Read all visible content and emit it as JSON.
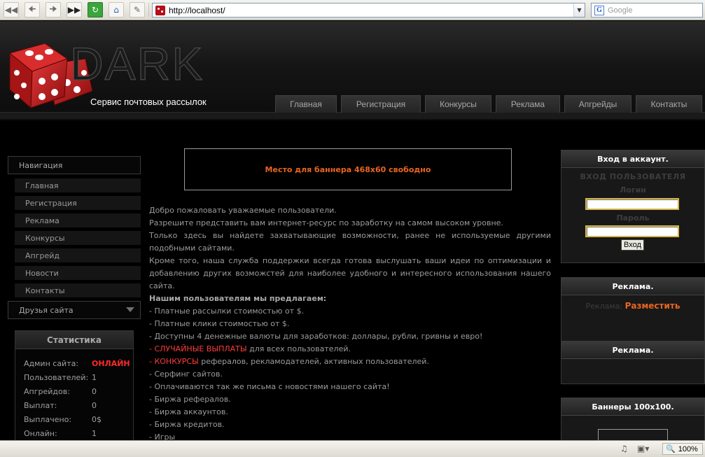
{
  "browser": {
    "url": "http://localhost/",
    "search_placeholder": "Google",
    "zoom": "100%",
    "icons": [
      "back-icon",
      "forward-icon",
      "fast-forward-icon",
      "refresh-icon",
      "home-icon",
      "edit-icon",
      "favicon-icon",
      "search-google-icon",
      "speaker-icon",
      "camera-icon",
      "zoom-icon"
    ]
  },
  "header": {
    "logo_text": "DARK",
    "slogan": "Сервис почтовых рассылок",
    "nav": [
      "Главная",
      "Регистрация",
      "Конкурсы",
      "Реклама",
      "Апгрейды",
      "Контакты"
    ]
  },
  "sidebar": {
    "nav_title": "Навигация",
    "items": [
      "Главная",
      "Регистрация",
      "Реклама",
      "Конкурсы",
      "Апгрейд",
      "Новости",
      "Контакты"
    ],
    "friends": "Друзья сайта",
    "stats_title": "Статистика",
    "stats": [
      {
        "label": "Админ сайта:",
        "value": "ОНЛАЙН"
      },
      {
        "label": "Пользователей:",
        "value": "1"
      },
      {
        "label": "Апгрейдов:",
        "value": "0"
      },
      {
        "label": "Выплат:",
        "value": "0"
      },
      {
        "label": "Выплачено:",
        "value": "0$"
      },
      {
        "label": "Онлайн:",
        "value": "1"
      }
    ]
  },
  "main": {
    "banner": "Место для баннера 468x60 свободно",
    "intro": [
      "Добро пожаловать уважаемые пользователи.",
      "Разрешите представить вам интернет-ресурс по заработку на самом высоком уровне.",
      "Только здесь вы найдете захватывающие возможности, ранее не используемые другими подобными сайтами.",
      "Кроме того, наша служба поддержки всегда готова выслушать ваши идеи по оптимизации и добавлению других возможстей для наиболее удобного и интересного использования нашего сайта."
    ],
    "offer_title": "Нашим пользователям мы предлагаем:",
    "offers": [
      "- Платные рассылки стоимостью от $.",
      "- Платные клики стоимостью от $.",
      "- Доступны 4 денежные валюты для заработков: доллары, рубли, гривны и евро!"
    ],
    "offer_random_prefix": "- ",
    "offer_random_hl": "СЛУЧАЙНЫЕ ВЫПЛАТЫ",
    "offer_random_rest": " для всех пользователей.",
    "offer_contest_prefix": "- ",
    "offer_contest_hl": "КОНКУРСЫ",
    "offer_contest_rest": " рефералов, рекламодателей, активных пользователей.",
    "offers_tail": [
      "- Серфинг сайтов.",
      "- Оплачиваются так же письма с новостями нашего сайта!",
      "- Биржа рефералов.",
      "- Биржа аккаунтов.",
      "- Биржа кредитов.",
      "- Игры"
    ]
  },
  "right": {
    "login_head": "Вход в аккаунт.",
    "login_title": "ВХОД ПОЛЬЗОВАТЕЛЯ",
    "login_label": "Логин",
    "password_label": "Пароль",
    "login_value": "",
    "password_value": "",
    "login_button": "Вход",
    "ad1_head": "Реклама.",
    "ad1_text": "Реклама:",
    "ad1_link": "Разместить",
    "ad2_head": "Реклама.",
    "banners_head": "Баннеры 100x100."
  },
  "colors": {
    "accent": "#e8651f",
    "online": "#ff2a2a",
    "highlight": "#ff3c3c"
  }
}
